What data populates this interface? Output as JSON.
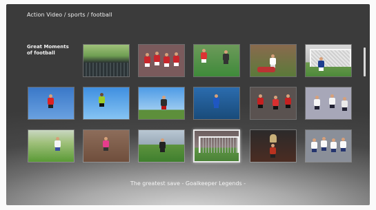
{
  "header": {
    "breadcrumb": "Action Video / sports / football"
  },
  "row_label": {
    "text": "Great Moments of football"
  },
  "caption": {
    "text": "The greatest save - Goalkeeper Legends -"
  },
  "tiles": [
    {
      "name": "thumb-stadium-crowd",
      "style": "stadium"
    },
    {
      "name": "thumb-red-team-players",
      "style": "redteam"
    },
    {
      "name": "thumb-players-on-pitch",
      "style": "pitch"
    },
    {
      "name": "thumb-slide-tackle",
      "style": "tackle"
    },
    {
      "name": "thumb-goal-net-scene",
      "style": "goalnet"
    },
    {
      "name": "thumb-red-player-kick",
      "style": "skykick"
    },
    {
      "name": "thumb-goalkeeper-jump",
      "style": "keeperjump"
    },
    {
      "name": "thumb-player-volley",
      "style": "volley"
    },
    {
      "name": "thumb-blue-player-cheer",
      "style": "bluecheer"
    },
    {
      "name": "thumb-red-players-group",
      "style": "redgroup"
    },
    {
      "name": "thumb-white-players-celebrate",
      "style": "whitecelebrate"
    },
    {
      "name": "thumb-player-running",
      "style": "running"
    },
    {
      "name": "thumb-goalkeeper-dive",
      "style": "keeperdive"
    },
    {
      "name": "thumb-goal-mouth-action",
      "style": "goalmouth"
    },
    {
      "name": "thumb-goal-save-selected",
      "style": "goalsave"
    },
    {
      "name": "thumb-trophy-lift",
      "style": "trophy"
    },
    {
      "name": "thumb-team-celebration",
      "style": "teamcelebrate"
    }
  ],
  "colors": {
    "selection_border": "#e8e8e8",
    "text": "#f0f0f0"
  }
}
